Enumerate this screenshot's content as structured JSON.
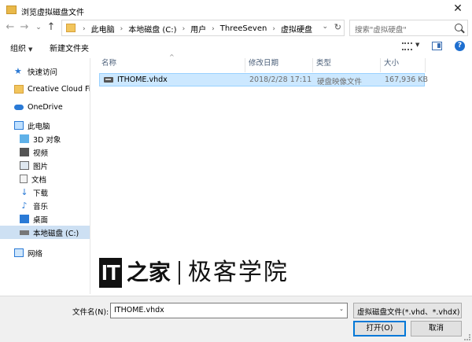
{
  "window": {
    "title": "浏览虚拟磁盘文件",
    "close_glyph": "✕"
  },
  "nav": {
    "back_glyph": "←",
    "forward_glyph": "→",
    "recent_glyph": "⌄",
    "up_glyph": "↑"
  },
  "address": {
    "crumbs": [
      "此电脑",
      "本地磁盘 (C:)",
      "用户",
      "ThreeSeven",
      "虚拟硬盘"
    ],
    "separator": "›",
    "dropdown_glyph": "⌄",
    "refresh_glyph": "↻"
  },
  "search": {
    "placeholder": "搜索\"虚拟硬盘\""
  },
  "toolbar": {
    "organize": "组织",
    "new_folder": "新建文件夹",
    "caret": "▼",
    "view_caret": "▼",
    "help": "?"
  },
  "sidebar": {
    "quick_access": "快速访问",
    "creative_cloud": "Creative Cloud Files",
    "onedrive": "OneDrive",
    "this_pc": "此电脑",
    "pc_items": [
      "3D 对象",
      "视频",
      "图片",
      "文档",
      "下载",
      "音乐",
      "桌面",
      "本地磁盘 (C:)"
    ],
    "network": "网络"
  },
  "columns": {
    "name": "名称",
    "modified": "修改日期",
    "type": "类型",
    "size": "大小",
    "sort_glyph": "^"
  },
  "files": [
    {
      "name": "ITHOME.vhdx",
      "modified": "2018/2/28 17:11",
      "type": "硬盘映像文件",
      "size": "167,936 KB"
    }
  ],
  "watermark": {
    "it": "IT",
    "zhi": "之家",
    "text": "极客学院"
  },
  "footer": {
    "filename_label": "文件名(N):",
    "filename_value": "ITHOME.vhdx",
    "filetype_value": "虚拟磁盘文件(*.vhd、*.vhdx)",
    "open_button": "打开(O)",
    "cancel_button": "取消",
    "caret": "⌄"
  },
  "colors": {
    "selection": "#cce8ff",
    "sidebar_selected": "#cde0f3",
    "accent": "#0078d7"
  }
}
